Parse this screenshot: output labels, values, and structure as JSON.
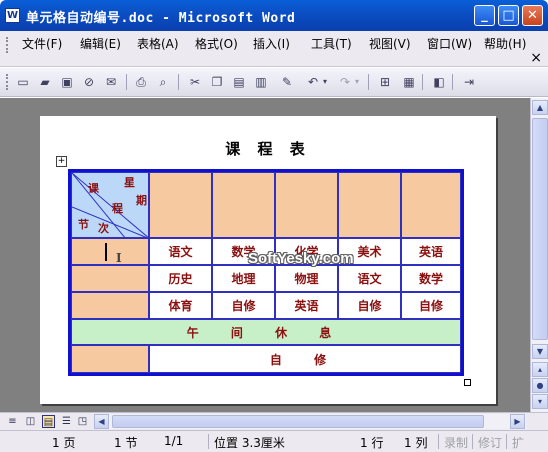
{
  "window": {
    "title": "单元格自动编号.doc - Microsoft Word",
    "app_icon": "W"
  },
  "menu": {
    "items": [
      "文件(F)",
      "编辑(E)",
      "表格(A)",
      "格式(O)",
      "插入(I)",
      "工具(T)",
      "视图(V)",
      "窗口(W)",
      "帮助(H)"
    ],
    "doc_close": "×"
  },
  "toolbar": {
    "icons": [
      "new-document-icon",
      "open-folder-icon",
      "save-icon",
      "permission-icon",
      "email-icon",
      "print-icon",
      "print-preview-icon",
      "cut-icon",
      "copy-icon",
      "paste-icon",
      "paste-special-icon",
      "format-painter-icon",
      "undo-icon",
      "redo-icon",
      "insert-table-icon",
      "insert-excel-icon",
      "research-icon",
      "show-hide-icon"
    ]
  },
  "document": {
    "title": "课 程 表",
    "corner": {
      "top_right_1": "星",
      "top_right_2": "期",
      "left_1": "课",
      "left_2": "程",
      "bottom_1": "节",
      "bottom_2": "次"
    },
    "rows": [
      [
        "语文",
        "数学",
        "化学",
        "美术",
        "英语"
      ],
      [
        "历史",
        "地理",
        "物理",
        "语文",
        "数学"
      ],
      [
        "体育",
        "自修",
        "英语",
        "自修",
        "自修"
      ]
    ],
    "lunch_break": "午 间 休 息",
    "self_study": "自 修",
    "watermark": "SoftYesky.com"
  },
  "status": {
    "page": "1 页",
    "section": "1 节",
    "page_of": "1/1",
    "position": "位置 3.3厘米",
    "line": "1 行",
    "column": "1 列",
    "rec": "录制",
    "trk": "修订",
    "ext": "扩"
  },
  "colors": {
    "peach": "#f6c9a0",
    "corner_blue": "#bcd8f8",
    "lunch_green": "#c8f0c8",
    "table_border": "#1010d0",
    "text_red": "#8b1010"
  }
}
